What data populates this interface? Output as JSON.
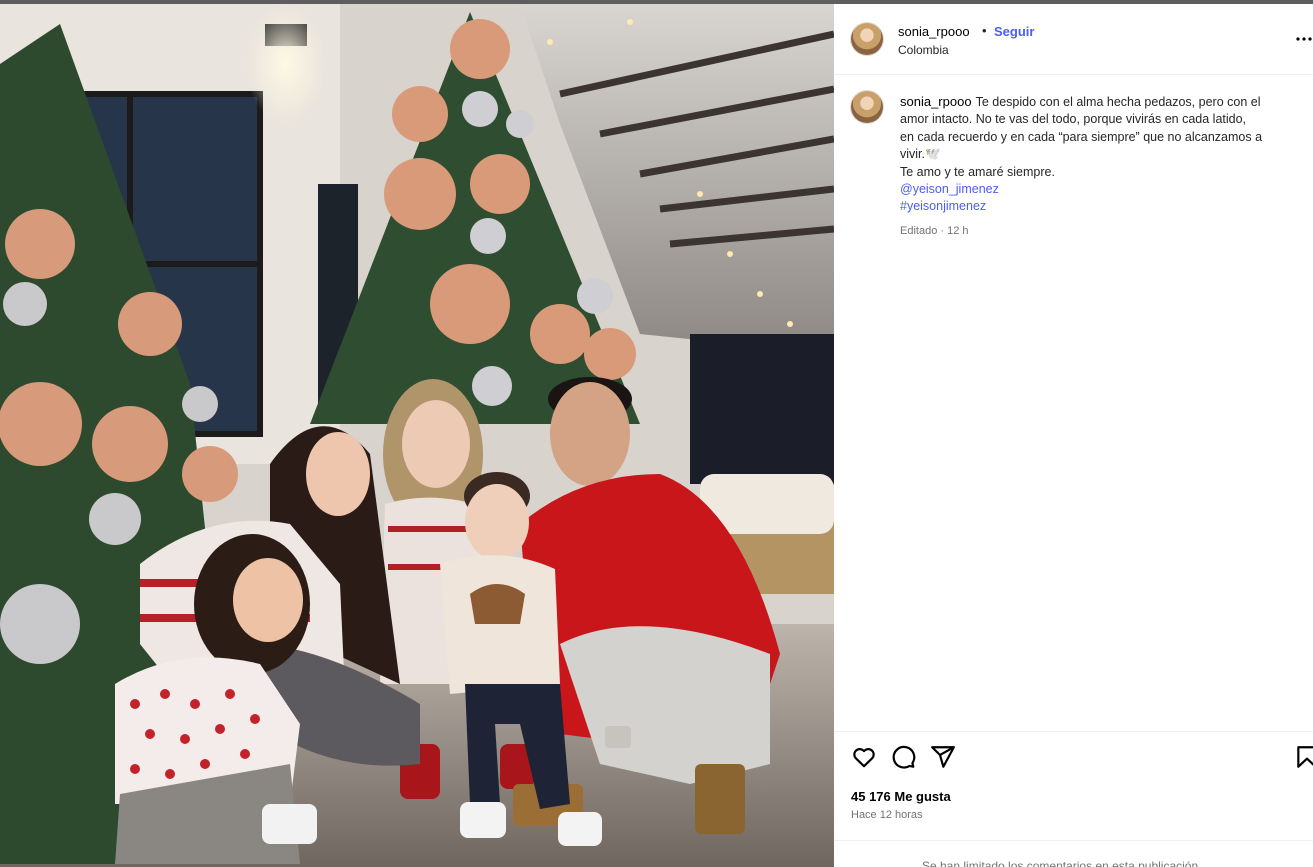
{
  "post": {
    "username": "sonia_rpooo",
    "separator": "•",
    "follow_label": "Seguir",
    "location": "Colombia",
    "more_label": "...",
    "caption": {
      "line1": "Te despido con el alma hecha pedazos, pero con el",
      "line2": "amor intacto. No te vas del todo, porque vivirás en cada latido,",
      "line3": "en cada recuerdo y en cada “para siempre” que no alcanzamos a",
      "line4": "vivir.🕊️",
      "line5": "Te amo y te amaré siempre.",
      "mention": "@yeison_jimenez",
      "hashtag": "#yeisonjimenez"
    },
    "edited_meta": "Editado · 12 h",
    "likes": "45 176 Me gusta",
    "time_ago": "Hace 12 horas",
    "comments_limited": "Se han limitado los comentarios en esta publicación"
  },
  "icons": {
    "like": "heart-icon",
    "comment": "comment-icon",
    "share": "paper-plane-icon",
    "save": "bookmark-icon"
  },
  "colors": {
    "link": "#4a5df9",
    "secondary_text": "#737373",
    "sweater_red": "#c8161b"
  }
}
